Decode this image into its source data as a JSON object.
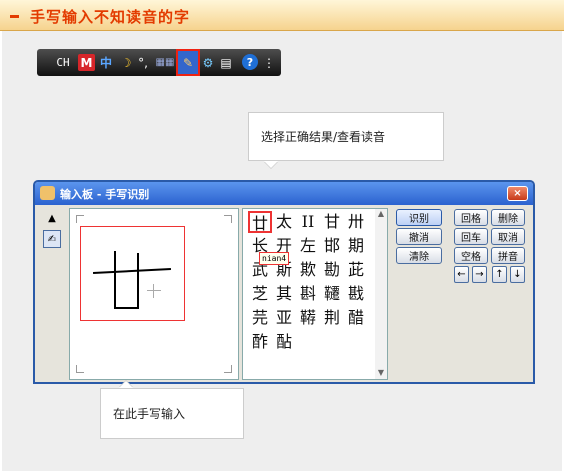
{
  "header": {
    "title": "手写输入不知读音的字"
  },
  "toolbar": {
    "ch": "CH",
    "m": "M",
    "lang": "中",
    "moon": "☽",
    "punc": "°,",
    "keyboard": "▦▦",
    "tool": "⚙",
    "doc": "▤",
    "help": "?"
  },
  "callout_top": "选择正确结果/查看读音",
  "callout_bottom": "在此手写输入",
  "window": {
    "title": "输入板 - 手写识别",
    "close": "×",
    "candidates": [
      "廿",
      "太",
      "II",
      "甘",
      "卅",
      "长",
      "开",
      "左",
      "邯",
      "期",
      "武",
      "斯",
      "欺",
      "勘",
      "茈",
      "芝",
      "其",
      "斟",
      "韆",
      "戡",
      "芫",
      "亚",
      "鞯",
      "荆",
      "醋",
      "酢",
      "酟"
    ],
    "pinyin_tip": "nian4",
    "buttons": {
      "recognize": "识别",
      "undo": "撤消",
      "clear": "清除",
      "backspace": "回格",
      "delete": "删除",
      "enter": "回车",
      "cancel": "取消",
      "space": "空格",
      "pinyin": "拼音"
    },
    "arrows": [
      "←",
      "→",
      "↑",
      "↓"
    ]
  },
  "colors": {
    "accent": "#e33b00",
    "window_border": "#2a5aa8",
    "highlight": "#e33333"
  }
}
